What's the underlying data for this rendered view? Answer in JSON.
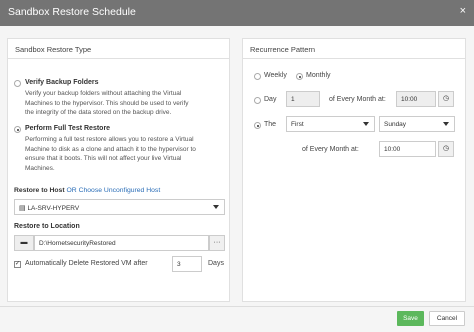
{
  "dialog": {
    "title": "Sandbox Restore Schedule",
    "close": "×"
  },
  "left": {
    "title": "Sandbox Restore Type",
    "verify_label": "Verify Backup Folders",
    "verify_desc": [
      "Verify your backup folders without attaching the Virtual",
      "Machines to the hypervisor. This should be used to verify",
      "the integrity of the data stored on the backup drive."
    ],
    "full_label": "Perform Full Test Restore",
    "full_desc": [
      "Performing a full test restore allows you to restore a Virtual",
      "Machine to disk as a clone and attach it to the hypervisor to",
      "ensure that it boots. This will not affect your live Virtual",
      "Machines."
    ],
    "restore_host_label": "Restore to Host",
    "or_text": "OR",
    "choose_link": "Choose Unconfigured Host",
    "host_value": "LA-SRV-HYPERV",
    "restore_location_label": "Restore to Location",
    "location_value": "D:\\HornetsecurityRestored",
    "auto_delete_label": "Automatically Delete Restored VM after",
    "days_value": "3",
    "days_label": "Days"
  },
  "right": {
    "title": "Recurrence Pattern",
    "weekly": "Weekly",
    "monthly": "Monthly",
    "day_label": "Day",
    "day_value": "1",
    "every_month_at_1": "of Every Month at:",
    "time_1": "10:00",
    "the_label": "The",
    "week_value": "First",
    "weekday_value": "Sunday",
    "every_month_at_2": "of Every Month at:",
    "time_2": "10:00"
  },
  "footer": {
    "save": "Save",
    "cancel": "Cancel"
  }
}
